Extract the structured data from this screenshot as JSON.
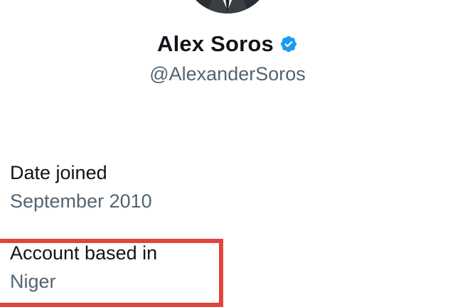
{
  "profile": {
    "name": "Alex Soros",
    "handle": "@AlexanderSoros",
    "verified_icon": "verified-badge-icon",
    "verified_color": "#1d9bf0"
  },
  "about": {
    "date_joined_label": "Date joined",
    "date_joined_value": "September 2010",
    "location_label": "Account based in",
    "location_value": "Niger"
  },
  "colors": {
    "primary_text": "#0f1419",
    "secondary_text": "#536471",
    "highlight": "#e0453a"
  }
}
